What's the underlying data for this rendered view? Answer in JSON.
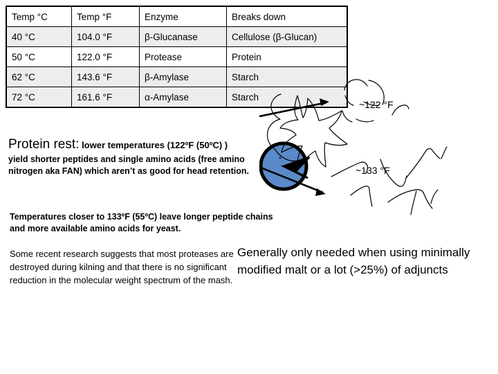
{
  "table": {
    "headers": [
      "Temp °C",
      "Temp °F",
      "Enzyme",
      "Breaks down"
    ],
    "rows": [
      {
        "shaded": true,
        "cells": [
          "40 °C",
          "104.0 °F",
          "β-Glucanase",
          "Cellulose (β-Glucan)"
        ]
      },
      {
        "shaded": false,
        "cells": [
          "50 °C",
          "122.0 °F",
          "Protease",
          "Protein"
        ]
      },
      {
        "shaded": true,
        "cells": [
          "62 °C",
          "143.6 °F",
          "β-Amylase",
          "Starch"
        ]
      },
      {
        "shaded": true,
        "cells": [
          "72 °C",
          "161.6 °F",
          "α-Amylase",
          "Starch"
        ]
      }
    ]
  },
  "protein_rest": {
    "heading": "Protein rest:",
    "lead": "lower temperatures (122ºF (50ºC) )",
    "body": "yield shorter peptides and single amino acids (free amino nitrogen aka FAN) which aren’t as good for head retention."
  },
  "temps_note": "Temperatures closer to 133ºF (55ºC) leave longer peptide chains and more available amino acids for yeast.",
  "research_note": "Some recent research suggests that most proteases are destroyed during kilning and that there is no significant  reduction in the molecular weight spectrum of the mash.",
  "adjunct_note": "Generally only needed when using minimally modified malt or a lot (>25%) of adjuncts",
  "diagram": {
    "label_122": "~122 °F",
    "label_133": "~133 °F",
    "protein_blob_color": "#5B8AC8",
    "outline_color": "#000000"
  }
}
